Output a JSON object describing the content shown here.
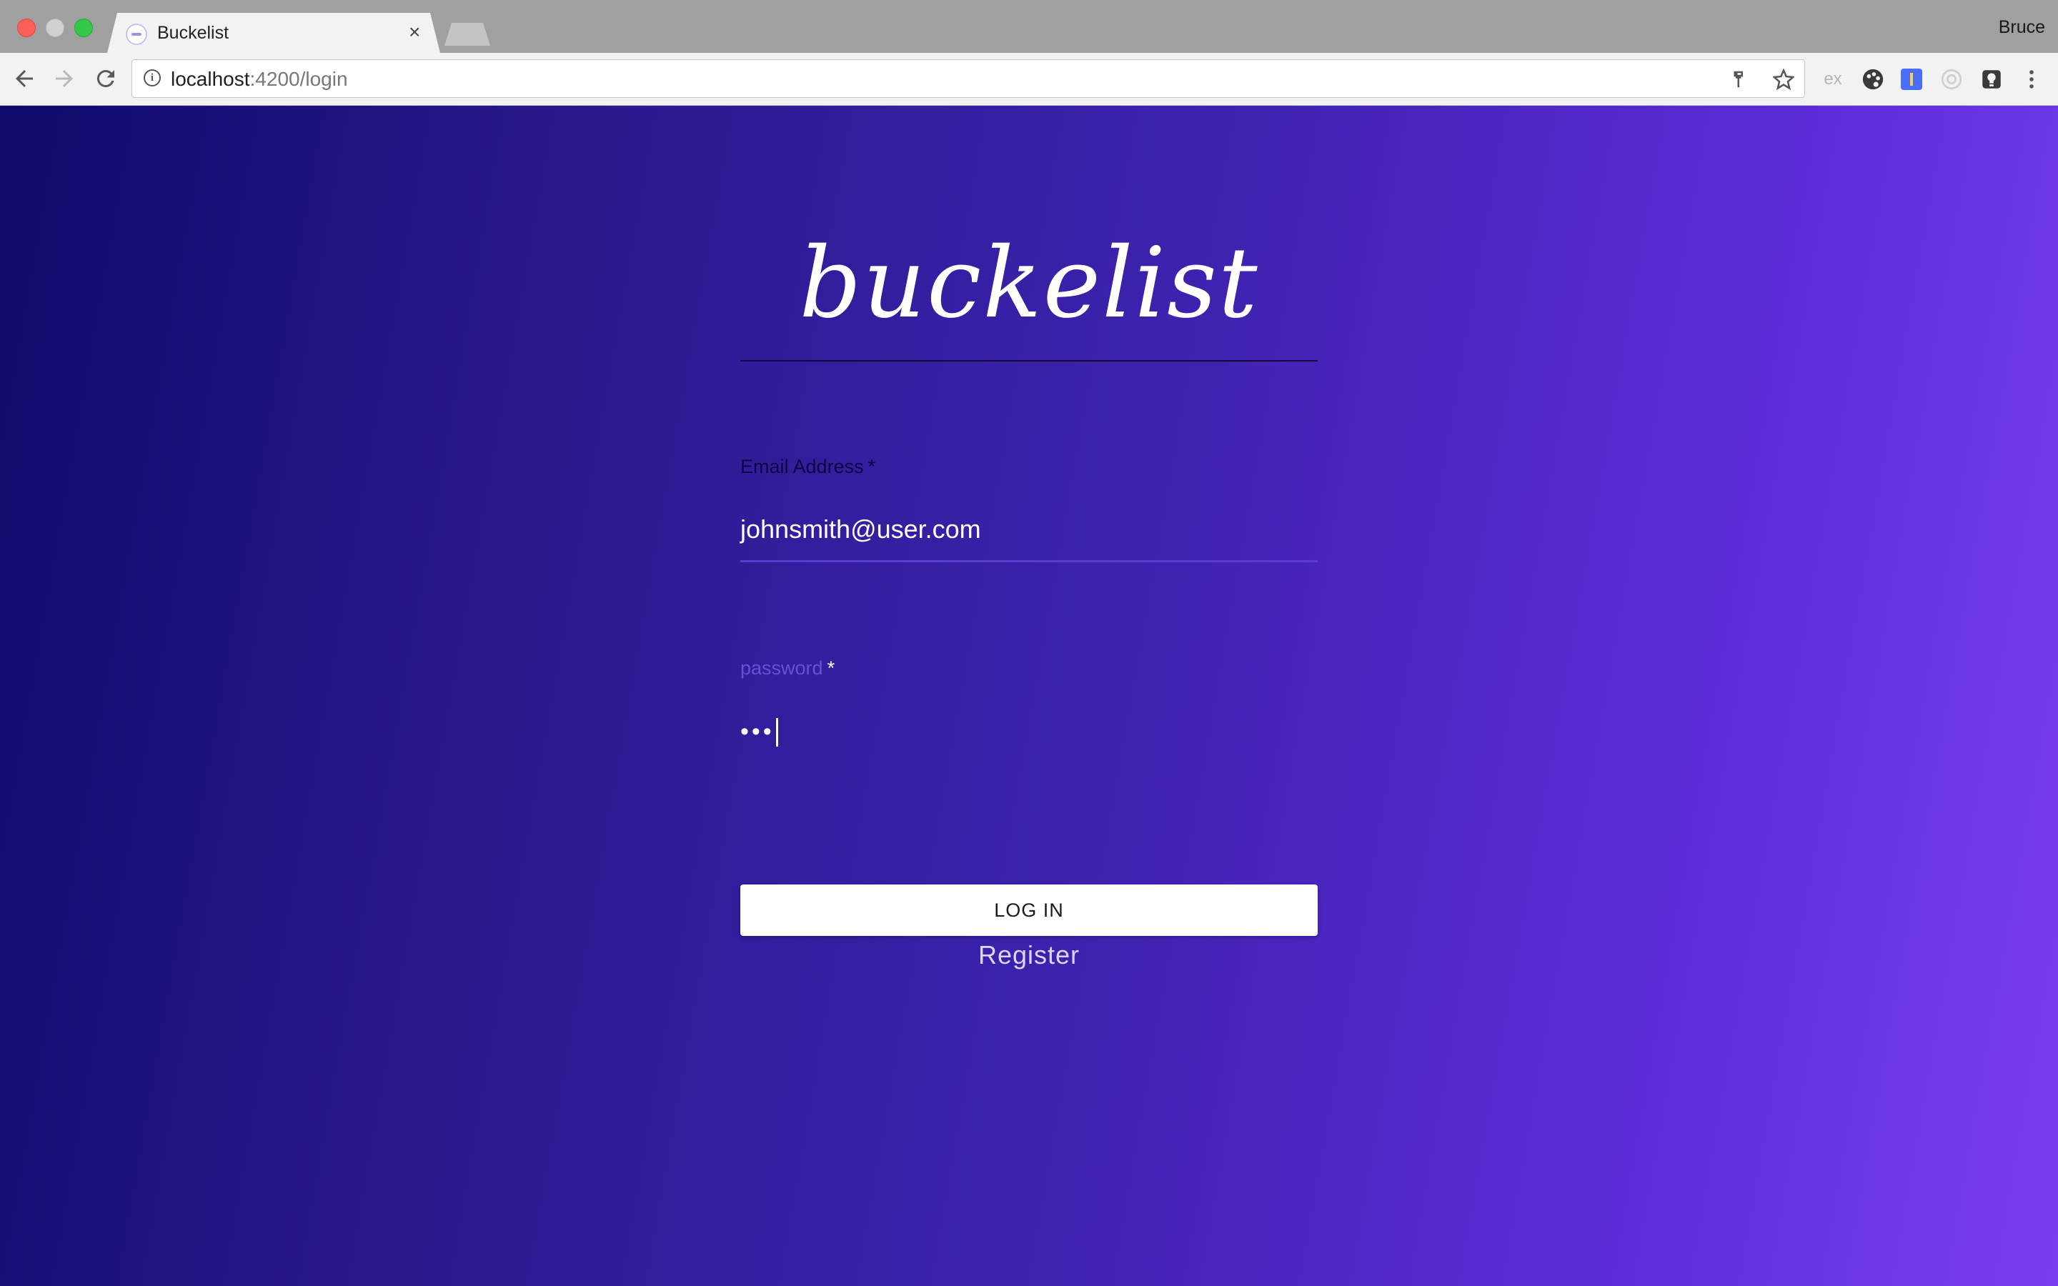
{
  "browser": {
    "tab_title": "Buckelist",
    "tab_close": "×",
    "profile_name": "Bruce",
    "url_host": "localhost",
    "url_rest": ":4200/login",
    "extension_ex_label": "ex"
  },
  "page": {
    "logo_text": "buckelist",
    "email_label": "Email Address",
    "email_required": "*",
    "email_value": "johnsmith@user.com",
    "password_label": "password",
    "password_required": "*",
    "password_mask": "•••",
    "login_button": "LOG IN",
    "register_link": "Register"
  },
  "colors": {
    "gradient_start": "#0f0a6b",
    "gradient_end": "#7a3ef0",
    "email_label": "#0c0640",
    "password_label": "#6b4fd3"
  },
  "icons": [
    "back-icon",
    "forward-icon",
    "reload-icon",
    "info-icon",
    "key-icon",
    "star-icon",
    "palette-icon",
    "menu-icon",
    "bulb-icon"
  ]
}
